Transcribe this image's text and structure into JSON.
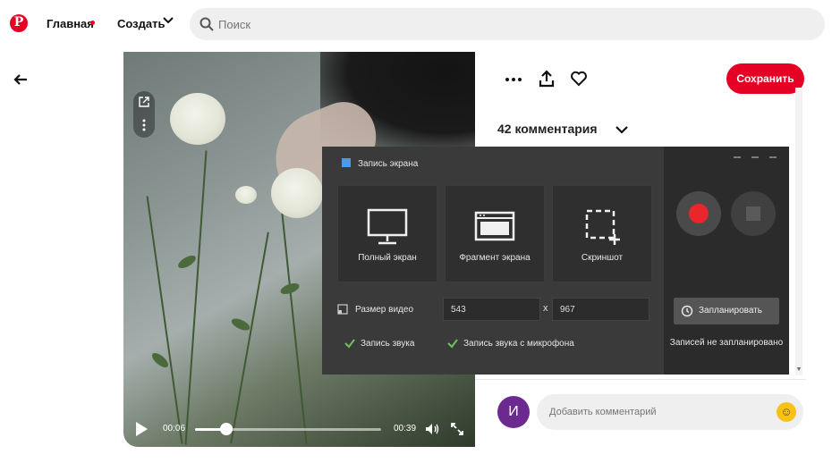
{
  "header": {
    "logo_letter": "P",
    "home_label": "Главная",
    "create_label": "Создать",
    "search_placeholder": "Поиск"
  },
  "video": {
    "current_time": "00:06",
    "duration": "00:39",
    "progress_fraction": 0.17
  },
  "pin": {
    "save_label": "Сохранить",
    "comments_label": "42 комментария",
    "avatar_letter": "И",
    "comment_placeholder": "Добавить комментарий",
    "emoji": "☺"
  },
  "recorder": {
    "title": "Запись экрана",
    "modes": [
      {
        "label": "Полный экран",
        "icon": "monitor-icon"
      },
      {
        "label": "Фрагмент экрана",
        "icon": "window-icon"
      },
      {
        "label": "Скриншот",
        "icon": "screenshot-crop-icon"
      }
    ],
    "size_label": "Размер видео",
    "width_value": "543",
    "height_value": "967",
    "size_separator": "x",
    "sound_label": "Запись звука",
    "mic_label": "Запись звука с микрофона",
    "schedule_label": "Запланировать",
    "no_schedule_text": "Записей не запланировано"
  },
  "colors": {
    "brand_red": "#e60023",
    "record_red": "#e8262c",
    "check_green": "#6fc25a"
  }
}
